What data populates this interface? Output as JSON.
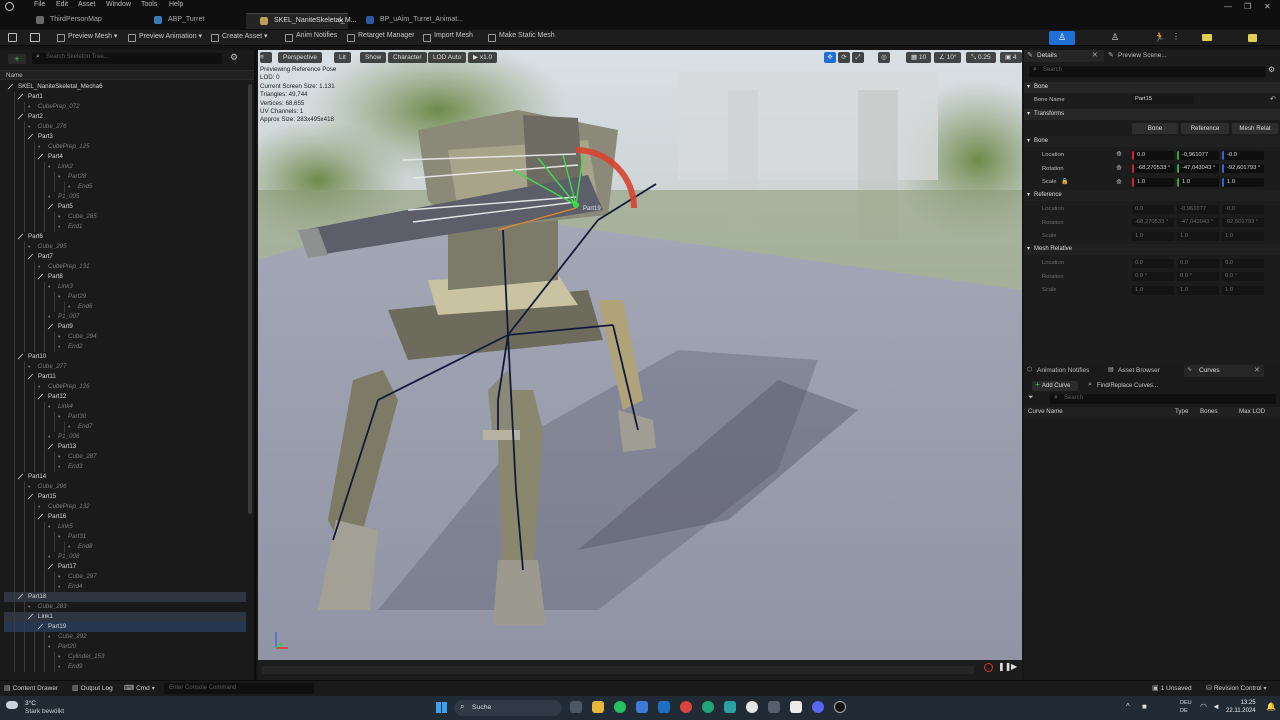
{
  "menus": [
    "File",
    "Edit",
    "Asset",
    "Window",
    "Tools",
    "Help"
  ],
  "tabs": [
    {
      "label": "ThirdPersonMap",
      "active": false
    },
    {
      "label": "ABP_Turret",
      "active": false
    },
    {
      "label": "SKEL_NaniteSkeletal_M...",
      "active": true
    },
    {
      "label": "BP_uAim_Turret_Animat...",
      "active": false
    }
  ],
  "toolbar": {
    "preview_mesh": "Preview Mesh",
    "preview_animation": "Preview Animation",
    "create_asset": "Create Asset",
    "anim_notifies": "Anim Notifies",
    "retarget_manager": "Retarget Manager",
    "import_mesh": "Import Mesh",
    "make_static_mesh": "Make Static Mesh"
  },
  "skeleton_tree": {
    "search_placeholder": "Search Skeleton Tree...",
    "column_name": "Name",
    "rows": [
      {
        "d": 0,
        "t": "SKEL_NaniteSkeletal_Mecha6",
        "k": "b"
      },
      {
        "d": 1,
        "t": "Part1",
        "k": "b"
      },
      {
        "d": 2,
        "t": "CubePrep_072",
        "k": "m"
      },
      {
        "d": 1,
        "t": "Part2",
        "k": "b"
      },
      {
        "d": 2,
        "t": "Cube_276",
        "k": "m"
      },
      {
        "d": 2,
        "t": "Part3",
        "k": "b"
      },
      {
        "d": 3,
        "t": "CubePrep_125",
        "k": "m"
      },
      {
        "d": 3,
        "t": "Part4",
        "k": "b"
      },
      {
        "d": 4,
        "t": "Link2",
        "k": "m"
      },
      {
        "d": 5,
        "t": "Part28",
        "k": "m"
      },
      {
        "d": 6,
        "t": "End5",
        "k": "m"
      },
      {
        "d": 4,
        "t": "P1_005",
        "k": "m"
      },
      {
        "d": 4,
        "t": "Part5",
        "k": "b"
      },
      {
        "d": 5,
        "t": "Cube_285",
        "k": "m"
      },
      {
        "d": 5,
        "t": "End1",
        "k": "m"
      },
      {
        "d": 1,
        "t": "Part6",
        "k": "b"
      },
      {
        "d": 2,
        "t": "Cube_295",
        "k": "m"
      },
      {
        "d": 2,
        "t": "Part7",
        "k": "b"
      },
      {
        "d": 3,
        "t": "CubePrep_131",
        "k": "m"
      },
      {
        "d": 3,
        "t": "Part8",
        "k": "b"
      },
      {
        "d": 4,
        "t": "Link3",
        "k": "m"
      },
      {
        "d": 5,
        "t": "Part29",
        "k": "m"
      },
      {
        "d": 6,
        "t": "End6",
        "k": "m"
      },
      {
        "d": 4,
        "t": "P1_007",
        "k": "m"
      },
      {
        "d": 4,
        "t": "Part9",
        "k": "b"
      },
      {
        "d": 5,
        "t": "Cube_294",
        "k": "m"
      },
      {
        "d": 5,
        "t": "End2",
        "k": "m"
      },
      {
        "d": 1,
        "t": "Part10",
        "k": "b"
      },
      {
        "d": 2,
        "t": "Cube_277",
        "k": "m"
      },
      {
        "d": 2,
        "t": "Part11",
        "k": "b"
      },
      {
        "d": 3,
        "t": "CubePrep_126",
        "k": "m"
      },
      {
        "d": 3,
        "t": "Part12",
        "k": "b"
      },
      {
        "d": 4,
        "t": "Link4",
        "k": "m"
      },
      {
        "d": 5,
        "t": "Part30",
        "k": "m"
      },
      {
        "d": 6,
        "t": "End7",
        "k": "m"
      },
      {
        "d": 4,
        "t": "P1_006",
        "k": "m"
      },
      {
        "d": 4,
        "t": "Part13",
        "k": "b"
      },
      {
        "d": 5,
        "t": "Cube_287",
        "k": "m"
      },
      {
        "d": 5,
        "t": "End3",
        "k": "m"
      },
      {
        "d": 1,
        "t": "Part14",
        "k": "b"
      },
      {
        "d": 2,
        "t": "Cube_296",
        "k": "m"
      },
      {
        "d": 2,
        "t": "Part15",
        "k": "b"
      },
      {
        "d": 3,
        "t": "CubePrep_132",
        "k": "m"
      },
      {
        "d": 3,
        "t": "Part16",
        "k": "b"
      },
      {
        "d": 4,
        "t": "Link5",
        "k": "m"
      },
      {
        "d": 5,
        "t": "Part31",
        "k": "m"
      },
      {
        "d": 6,
        "t": "End8",
        "k": "m"
      },
      {
        "d": 4,
        "t": "P1_008",
        "k": "m"
      },
      {
        "d": 4,
        "t": "Part17",
        "k": "b"
      },
      {
        "d": 5,
        "t": "Cube_297",
        "k": "m"
      },
      {
        "d": 5,
        "t": "End4",
        "k": "m"
      },
      {
        "d": 1,
        "t": "Part18",
        "k": "b",
        "sel": true
      },
      {
        "d": 2,
        "t": "Cube_283",
        "k": "m"
      },
      {
        "d": 2,
        "t": "Link1",
        "k": "b",
        "sel": true
      },
      {
        "d": 3,
        "t": "Part19",
        "k": "b",
        "hl": true
      },
      {
        "d": 4,
        "t": "Cube_292",
        "k": "m"
      },
      {
        "d": 4,
        "t": "Part20",
        "k": "m"
      },
      {
        "d": 5,
        "t": "Cylinder_153",
        "k": "m"
      },
      {
        "d": 5,
        "t": "End9",
        "k": "m"
      }
    ]
  },
  "viewport": {
    "perspective": "Perspective",
    "lit": "Lit",
    "show": "Show",
    "character": "Character",
    "lod": "LOD Auto",
    "play_speed": "x1.0",
    "grid_snap": "10",
    "rot_snap": "10°",
    "scale_snap": "0.25",
    "camera_speed": "4",
    "stats": [
      "Previewing Reference Pose",
      "LOD: 0",
      "Current Screen Size: 1.131",
      "Triangles: 49,744",
      "Vertices: 68,655",
      "UV Channels: 1",
      "Approx Size: 283x495x418"
    ],
    "bone_label": "Part19"
  },
  "details": {
    "tab": "Details",
    "tab2": "Preview Scene...",
    "search_placeholder": "Search",
    "section_bone": "Bone",
    "bone_name_label": "Bone Name",
    "bone_name_value": "Part15",
    "section_transforms": "Transforms",
    "mode_buttons": [
      "Bone",
      "Reference",
      "Mesh Relat"
    ],
    "sub_bone": "Bone",
    "location_label": "Location",
    "rotation_label": "Rotation",
    "scale_label": "Scale",
    "bone_location": [
      "0.0",
      "-0,961077",
      "-0.0"
    ],
    "bone_rotation": [
      "-68,270533 °",
      "-47,043043 °",
      "-92,601793 °"
    ],
    "bone_scale": [
      "1.0",
      "1.0",
      "1.0"
    ],
    "sub_reference": "Reference",
    "ref_location": [
      "0.0",
      "-0,961077",
      "-0.0"
    ],
    "ref_rotation": [
      "-68,270533 °",
      "-47,043043 °",
      "-92,601793 °"
    ],
    "ref_scale": [
      "1.0",
      "1.0",
      "1.0"
    ],
    "sub_mesh_relative": "Mesh Relative",
    "mr_location": [
      "0.0",
      "0.0",
      "0.0"
    ],
    "mr_rotation": [
      "0.0 °",
      "0.0 °",
      "0.0 °"
    ],
    "mr_scale": [
      "1.0",
      "1.0",
      "1.0"
    ]
  },
  "curves_panel": {
    "tabs": [
      "Animation Notifies",
      "Asset Browser",
      "Curves"
    ],
    "add_curve": "Add Curve",
    "find_replace": "Find/Replace Curves...",
    "search_placeholder": "Search",
    "columns": [
      "Curve Name",
      "Type",
      "Bones",
      "Max LOD"
    ]
  },
  "statusbar": {
    "content_drawer": "Content Drawer",
    "output_log": "Output Log",
    "cmd": "Cmd",
    "console_placeholder": "Enter Console Command",
    "unsaved": "1 Unsaved",
    "revision_control": "Revision Control"
  },
  "taskbar": {
    "weather_temp": "3°C",
    "weather_desc": "Stark bewölkt",
    "search": "Suche",
    "lang1": "DEU",
    "lang2": "DE",
    "time": "13:25",
    "date": "22.11.2024"
  },
  "colors": {
    "accent": "#1f6fd6",
    "selection": "#2e3440",
    "ground": "#9fa3b3"
  }
}
